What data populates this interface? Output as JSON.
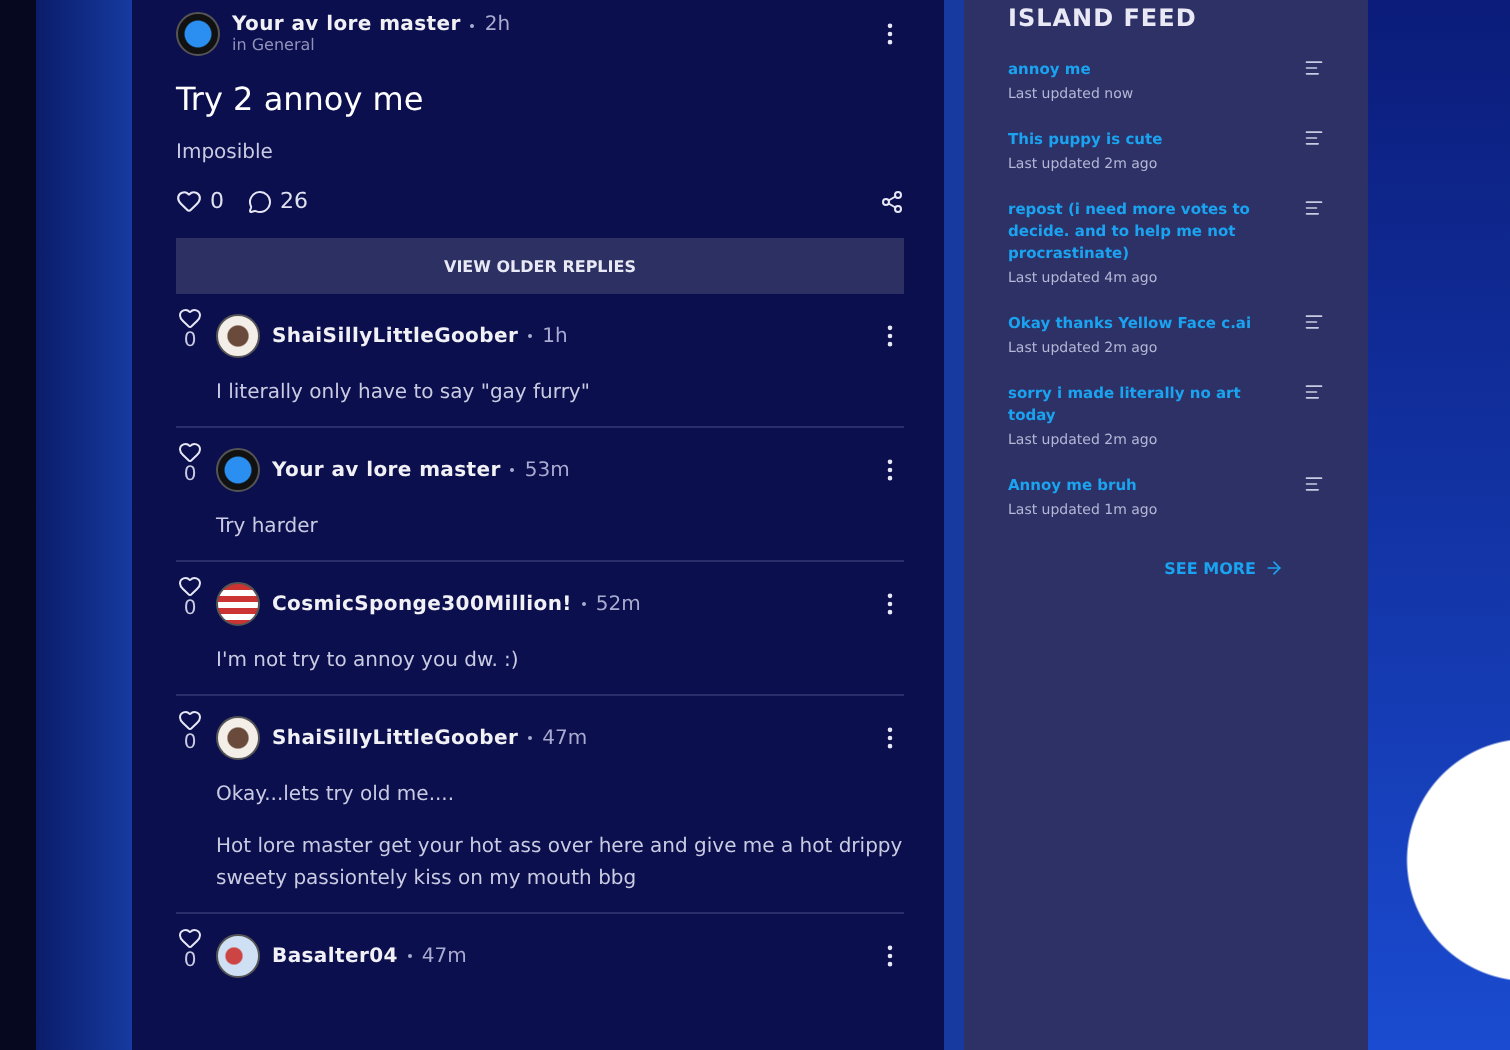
{
  "post": {
    "author": "Your av lore master",
    "time": "2h",
    "channel": "in General",
    "title": "Try 2 annoy me",
    "body": "Imposible",
    "likes": "0",
    "comments": "26"
  },
  "older_replies_button": "VIEW OLDER REPLIES",
  "replies": [
    {
      "author": "ShaiSillyLittleGoober",
      "time": "1h",
      "likes": "0",
      "kind": "dog",
      "paragraphs": [
        "I literally only have to say \"gay furry\""
      ]
    },
    {
      "author": "Your av lore master",
      "time": "53m",
      "likes": "0",
      "kind": "ball",
      "paragraphs": [
        "Try harder"
      ]
    },
    {
      "author": "CosmicSponge300Million!",
      "time": "52m",
      "likes": "0",
      "kind": "flag",
      "paragraphs": [
        "I'm not try to annoy you dw. :)"
      ]
    },
    {
      "author": "ShaiSillyLittleGoober",
      "time": "47m",
      "likes": "0",
      "kind": "dog",
      "paragraphs": [
        "Okay...lets try old me....",
        "Hot lore master get your hot ass over here and give me a hot drippy sweety passiontely kiss on my mouth bbg"
      ]
    },
    {
      "author": "Basalter04",
      "time": "47m",
      "likes": "0",
      "kind": "drawing"
    }
  ],
  "island_feed": {
    "title": "ISLAND FEED",
    "items": [
      {
        "title": "annoy me",
        "updated": "Last updated now"
      },
      {
        "title": "This puppy is cute",
        "updated": "Last updated 2m ago"
      },
      {
        "title": "repost (i need more votes to decide. and to help me not procrastinate)",
        "updated": "Last updated 4m ago"
      },
      {
        "title": "Okay thanks Yellow Face c.ai",
        "updated": "Last updated 2m ago"
      },
      {
        "title": "sorry i made literally no art today",
        "updated": "Last updated 2m ago"
      },
      {
        "title": "Annoy me bruh",
        "updated": "Last updated 1m ago"
      }
    ],
    "see_more": "SEE MORE"
  }
}
